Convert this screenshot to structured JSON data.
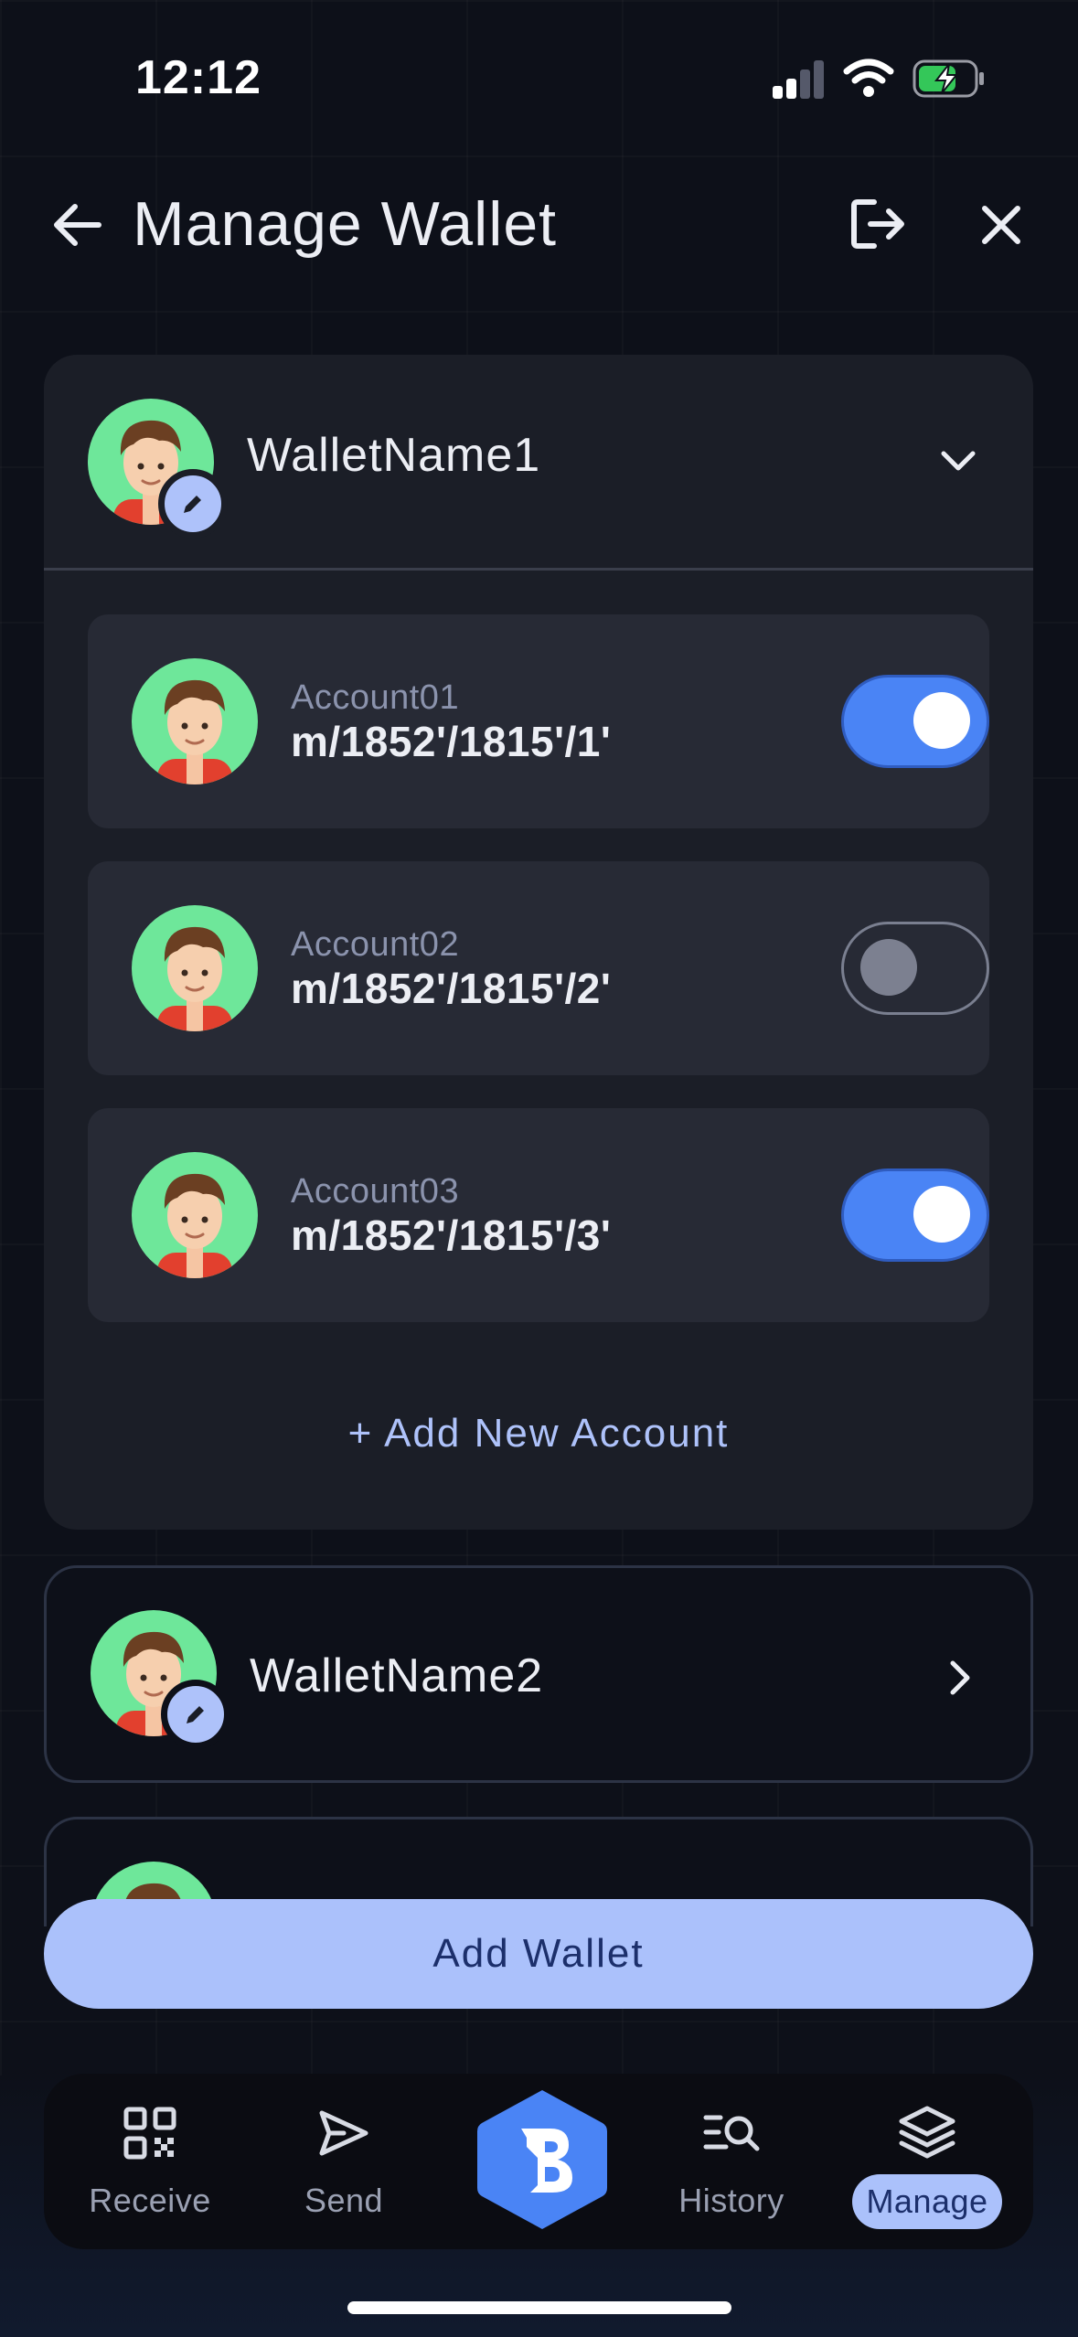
{
  "status_bar": {
    "time": "12:12"
  },
  "header": {
    "title": "Manage Wallet"
  },
  "wallets": [
    {
      "name": "WalletName1",
      "expanded": true,
      "accounts": [
        {
          "label": "Account01",
          "path": "m/1852'/1815'/1'",
          "enabled": true
        },
        {
          "label": "Account02",
          "path": "m/1852'/1815'/2'",
          "enabled": false
        },
        {
          "label": "Account03",
          "path": "m/1852'/1815'/3'",
          "enabled": true
        }
      ],
      "add_account_label": "+ Add New Account"
    },
    {
      "name": "WalletName2",
      "expanded": false
    }
  ],
  "add_wallet_label": "Add Wallet",
  "bottom_nav": {
    "items": [
      {
        "label": "Receive",
        "icon": "qr-code-icon"
      },
      {
        "label": "Send",
        "icon": "send-icon"
      },
      {
        "label": "",
        "icon": "brand-logo-icon"
      },
      {
        "label": "History",
        "icon": "history-search-icon"
      },
      {
        "label": "Manage",
        "icon": "layers-icon",
        "active": true
      }
    ]
  },
  "colors": {
    "background": "#0d1019",
    "card": "#1b1e27",
    "account_card": "#272a35",
    "accent": "#4a84f5",
    "accent_light": "#abc1fb",
    "avatar_bg": "#6ee79a"
  }
}
